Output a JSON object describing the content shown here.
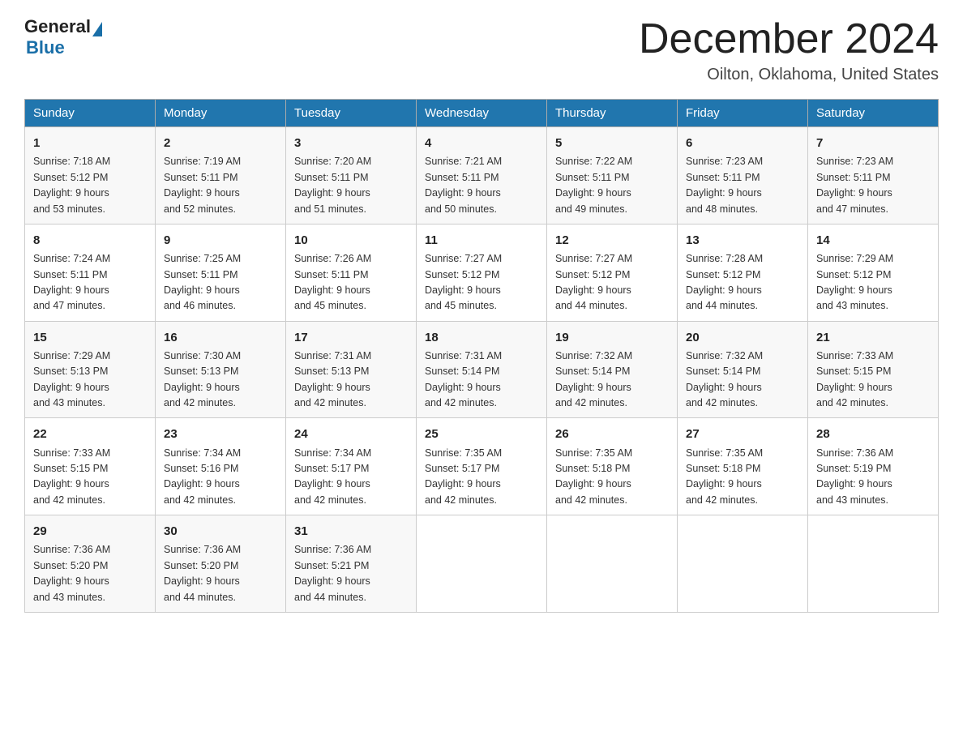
{
  "header": {
    "logo_general": "General",
    "logo_blue": "Blue",
    "month_title": "December 2024",
    "location": "Oilton, Oklahoma, United States"
  },
  "days_of_week": [
    "Sunday",
    "Monday",
    "Tuesday",
    "Wednesday",
    "Thursday",
    "Friday",
    "Saturday"
  ],
  "weeks": [
    [
      {
        "day": "1",
        "sunrise": "7:18 AM",
        "sunset": "5:12 PM",
        "daylight": "9 hours and 53 minutes."
      },
      {
        "day": "2",
        "sunrise": "7:19 AM",
        "sunset": "5:11 PM",
        "daylight": "9 hours and 52 minutes."
      },
      {
        "day": "3",
        "sunrise": "7:20 AM",
        "sunset": "5:11 PM",
        "daylight": "9 hours and 51 minutes."
      },
      {
        "day": "4",
        "sunrise": "7:21 AM",
        "sunset": "5:11 PM",
        "daylight": "9 hours and 50 minutes."
      },
      {
        "day": "5",
        "sunrise": "7:22 AM",
        "sunset": "5:11 PM",
        "daylight": "9 hours and 49 minutes."
      },
      {
        "day": "6",
        "sunrise": "7:23 AM",
        "sunset": "5:11 PM",
        "daylight": "9 hours and 48 minutes."
      },
      {
        "day": "7",
        "sunrise": "7:23 AM",
        "sunset": "5:11 PM",
        "daylight": "9 hours and 47 minutes."
      }
    ],
    [
      {
        "day": "8",
        "sunrise": "7:24 AM",
        "sunset": "5:11 PM",
        "daylight": "9 hours and 47 minutes."
      },
      {
        "day": "9",
        "sunrise": "7:25 AM",
        "sunset": "5:11 PM",
        "daylight": "9 hours and 46 minutes."
      },
      {
        "day": "10",
        "sunrise": "7:26 AM",
        "sunset": "5:11 PM",
        "daylight": "9 hours and 45 minutes."
      },
      {
        "day": "11",
        "sunrise": "7:27 AM",
        "sunset": "5:12 PM",
        "daylight": "9 hours and 45 minutes."
      },
      {
        "day": "12",
        "sunrise": "7:27 AM",
        "sunset": "5:12 PM",
        "daylight": "9 hours and 44 minutes."
      },
      {
        "day": "13",
        "sunrise": "7:28 AM",
        "sunset": "5:12 PM",
        "daylight": "9 hours and 44 minutes."
      },
      {
        "day": "14",
        "sunrise": "7:29 AM",
        "sunset": "5:12 PM",
        "daylight": "9 hours and 43 minutes."
      }
    ],
    [
      {
        "day": "15",
        "sunrise": "7:29 AM",
        "sunset": "5:13 PM",
        "daylight": "9 hours and 43 minutes."
      },
      {
        "day": "16",
        "sunrise": "7:30 AM",
        "sunset": "5:13 PM",
        "daylight": "9 hours and 42 minutes."
      },
      {
        "day": "17",
        "sunrise": "7:31 AM",
        "sunset": "5:13 PM",
        "daylight": "9 hours and 42 minutes."
      },
      {
        "day": "18",
        "sunrise": "7:31 AM",
        "sunset": "5:14 PM",
        "daylight": "9 hours and 42 minutes."
      },
      {
        "day": "19",
        "sunrise": "7:32 AM",
        "sunset": "5:14 PM",
        "daylight": "9 hours and 42 minutes."
      },
      {
        "day": "20",
        "sunrise": "7:32 AM",
        "sunset": "5:14 PM",
        "daylight": "9 hours and 42 minutes."
      },
      {
        "day": "21",
        "sunrise": "7:33 AM",
        "sunset": "5:15 PM",
        "daylight": "9 hours and 42 minutes."
      }
    ],
    [
      {
        "day": "22",
        "sunrise": "7:33 AM",
        "sunset": "5:15 PM",
        "daylight": "9 hours and 42 minutes."
      },
      {
        "day": "23",
        "sunrise": "7:34 AM",
        "sunset": "5:16 PM",
        "daylight": "9 hours and 42 minutes."
      },
      {
        "day": "24",
        "sunrise": "7:34 AM",
        "sunset": "5:17 PM",
        "daylight": "9 hours and 42 minutes."
      },
      {
        "day": "25",
        "sunrise": "7:35 AM",
        "sunset": "5:17 PM",
        "daylight": "9 hours and 42 minutes."
      },
      {
        "day": "26",
        "sunrise": "7:35 AM",
        "sunset": "5:18 PM",
        "daylight": "9 hours and 42 minutes."
      },
      {
        "day": "27",
        "sunrise": "7:35 AM",
        "sunset": "5:18 PM",
        "daylight": "9 hours and 42 minutes."
      },
      {
        "day": "28",
        "sunrise": "7:36 AM",
        "sunset": "5:19 PM",
        "daylight": "9 hours and 43 minutes."
      }
    ],
    [
      {
        "day": "29",
        "sunrise": "7:36 AM",
        "sunset": "5:20 PM",
        "daylight": "9 hours and 43 minutes."
      },
      {
        "day": "30",
        "sunrise": "7:36 AM",
        "sunset": "5:20 PM",
        "daylight": "9 hours and 44 minutes."
      },
      {
        "day": "31",
        "sunrise": "7:36 AM",
        "sunset": "5:21 PM",
        "daylight": "9 hours and 44 minutes."
      },
      null,
      null,
      null,
      null
    ]
  ],
  "labels": {
    "sunrise_prefix": "Sunrise: ",
    "sunset_prefix": "Sunset: ",
    "daylight_prefix": "Daylight: "
  }
}
